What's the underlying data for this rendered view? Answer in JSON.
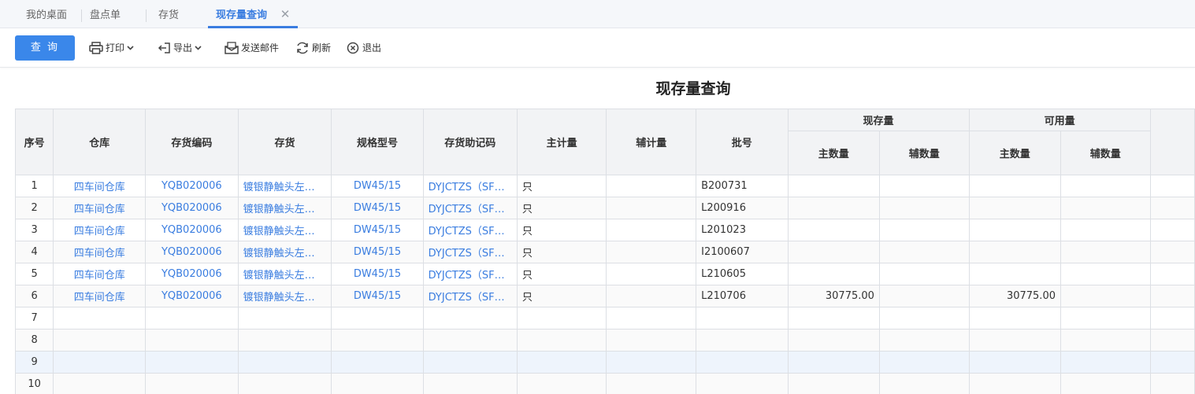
{
  "tabs": [
    {
      "label": "我的桌面",
      "active": false
    },
    {
      "label": "盘点单",
      "active": false
    },
    {
      "label": "存货",
      "active": false
    },
    {
      "label": "现存量查询",
      "active": true
    }
  ],
  "toolbar": {
    "query_label": "查 询",
    "print_label": "打印",
    "export_label": "导出",
    "email_label": "发送邮件",
    "refresh_label": "刷新",
    "exit_label": "退出"
  },
  "report": {
    "title": "现存量查询"
  },
  "grid": {
    "headers": {
      "seq": "序号",
      "warehouse": "仓库",
      "inv_code": "存货编码",
      "inv": "存货",
      "spec": "规格型号",
      "mnemonic": "存货助记码",
      "main_unit": "主计量",
      "aux_unit": "辅计量",
      "batch": "批号",
      "onhand_group": "现存量",
      "available_group": "可用量",
      "main_qty": "主数量",
      "aux_qty": "辅数量"
    },
    "rows": [
      {
        "seq": "1",
        "warehouse": "四车间仓库",
        "inv_code": "YQB020006",
        "inv": "镀银静触头左…",
        "spec": "DW45/15",
        "mnemonic": "DYJCTZS（SF…",
        "main_unit": "只",
        "aux_unit": "",
        "batch": "B200731",
        "onhand_main": "",
        "onhand_aux": "",
        "avail_main": "",
        "avail_aux": ""
      },
      {
        "seq": "2",
        "warehouse": "四车间仓库",
        "inv_code": "YQB020006",
        "inv": "镀银静触头左…",
        "spec": "DW45/15",
        "mnemonic": "DYJCTZS（SF…",
        "main_unit": "只",
        "aux_unit": "",
        "batch": "L200916",
        "onhand_main": "",
        "onhand_aux": "",
        "avail_main": "",
        "avail_aux": ""
      },
      {
        "seq": "3",
        "warehouse": "四车间仓库",
        "inv_code": "YQB020006",
        "inv": "镀银静触头左…",
        "spec": "DW45/15",
        "mnemonic": "DYJCTZS（SF…",
        "main_unit": "只",
        "aux_unit": "",
        "batch": "L201023",
        "onhand_main": "",
        "onhand_aux": "",
        "avail_main": "",
        "avail_aux": ""
      },
      {
        "seq": "4",
        "warehouse": "四车间仓库",
        "inv_code": "YQB020006",
        "inv": "镀银静触头左…",
        "spec": "DW45/15",
        "mnemonic": "DYJCTZS（SF…",
        "main_unit": "只",
        "aux_unit": "",
        "batch": "I2100607",
        "onhand_main": "",
        "onhand_aux": "",
        "avail_main": "",
        "avail_aux": ""
      },
      {
        "seq": "5",
        "warehouse": "四车间仓库",
        "inv_code": "YQB020006",
        "inv": "镀银静触头左…",
        "spec": "DW45/15",
        "mnemonic": "DYJCTZS（SF…",
        "main_unit": "只",
        "aux_unit": "",
        "batch": "L210605",
        "onhand_main": "",
        "onhand_aux": "",
        "avail_main": "",
        "avail_aux": ""
      },
      {
        "seq": "6",
        "warehouse": "四车间仓库",
        "inv_code": "YQB020006",
        "inv": "镀银静触头左…",
        "spec": "DW45/15",
        "mnemonic": "DYJCTZS（SF…",
        "main_unit": "只",
        "aux_unit": "",
        "batch": "L210706",
        "onhand_main": "30775.00",
        "onhand_aux": "",
        "avail_main": "30775.00",
        "avail_aux": ""
      },
      {
        "seq": "7",
        "warehouse": "",
        "inv_code": "",
        "inv": "",
        "spec": "",
        "mnemonic": "",
        "main_unit": "",
        "aux_unit": "",
        "batch": "",
        "onhand_main": "",
        "onhand_aux": "",
        "avail_main": "",
        "avail_aux": ""
      },
      {
        "seq": "8",
        "warehouse": "",
        "inv_code": "",
        "inv": "",
        "spec": "",
        "mnemonic": "",
        "main_unit": "",
        "aux_unit": "",
        "batch": "",
        "onhand_main": "",
        "onhand_aux": "",
        "avail_main": "",
        "avail_aux": ""
      },
      {
        "seq": "9",
        "warehouse": "",
        "inv_code": "",
        "inv": "",
        "spec": "",
        "mnemonic": "",
        "main_unit": "",
        "aux_unit": "",
        "batch": "",
        "onhand_main": "",
        "onhand_aux": "",
        "avail_main": "",
        "avail_aux": ""
      },
      {
        "seq": "10",
        "warehouse": "",
        "inv_code": "",
        "inv": "",
        "spec": "",
        "mnemonic": "",
        "main_unit": "",
        "aux_unit": "",
        "batch": "",
        "onhand_main": "",
        "onhand_aux": "",
        "avail_main": "",
        "avail_aux": ""
      }
    ]
  },
  "colors": {
    "accent": "#3a7de0",
    "button": "#3a87ea",
    "header_bg": "#f2f3f5",
    "highlight_row": "#eef4fc"
  },
  "icons": [
    "close-icon",
    "printer-icon",
    "export-icon",
    "mail-icon",
    "refresh-icon",
    "exit-icon",
    "chevron-down-icon"
  ]
}
